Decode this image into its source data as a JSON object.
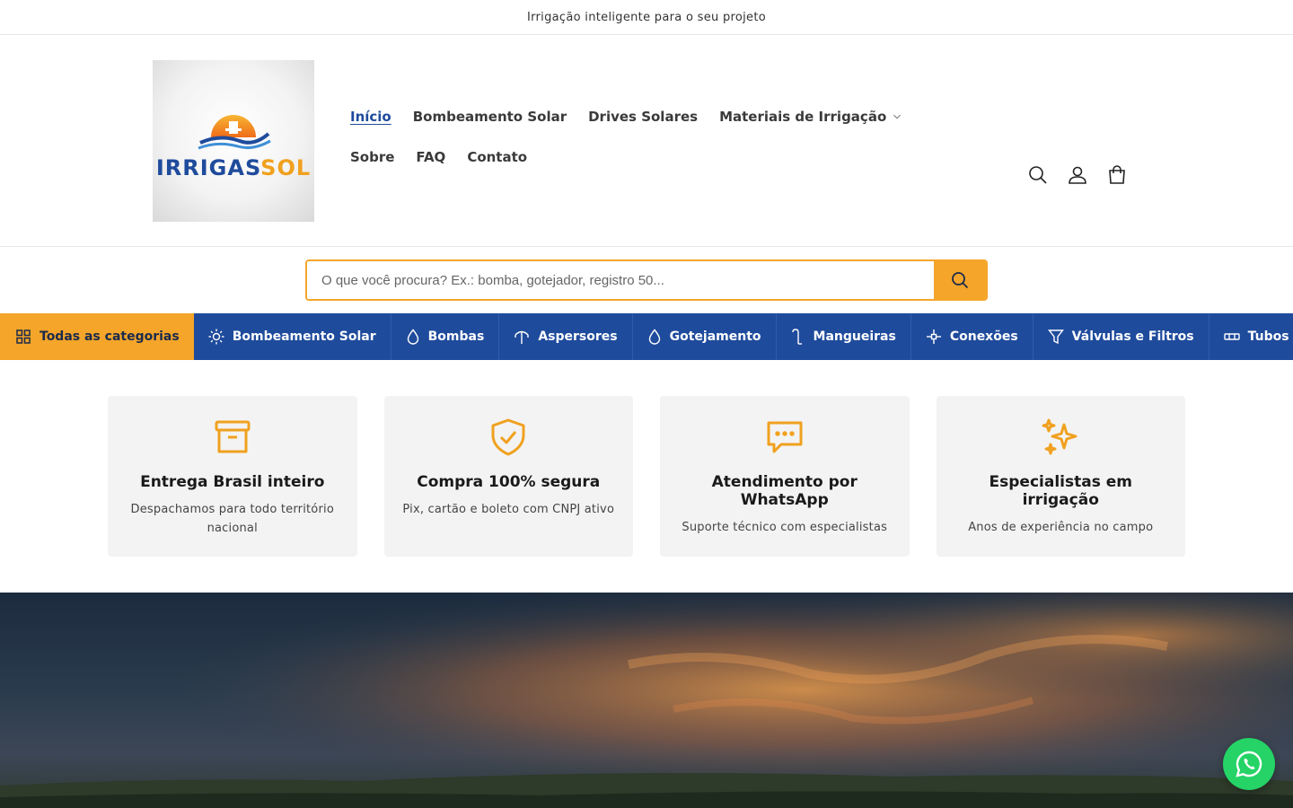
{
  "announcement": {
    "text": "Irrigação inteligente para o seu projeto"
  },
  "logo": {
    "word_a": "IRRIGAS",
    "word_b": "SOL"
  },
  "nav": {
    "items": [
      {
        "label": "Início",
        "active": true
      },
      {
        "label": "Bombeamento Solar"
      },
      {
        "label": "Drives Solares"
      },
      {
        "label": "Materiais de Irrigação",
        "has_dropdown": true
      },
      {
        "label": "Sobre"
      },
      {
        "label": "FAQ"
      },
      {
        "label": "Contato"
      }
    ]
  },
  "header_icons": [
    "search-icon",
    "account-icon",
    "cart-icon"
  ],
  "search": {
    "placeholder": "O que você procura? Ex.: bomba, gotejador, registro 50..."
  },
  "categories": {
    "all_label": "Todas as categorias",
    "items": [
      {
        "label": "Bombeamento Solar",
        "icon": "sun-icon"
      },
      {
        "label": "Bombas",
        "icon": "drop-icon"
      },
      {
        "label": "Aspersores",
        "icon": "sprinkler-icon"
      },
      {
        "label": "Gotejamento",
        "icon": "drop-icon"
      },
      {
        "label": "Mangueiras",
        "icon": "hose-icon"
      },
      {
        "label": "Conexões",
        "icon": "connection-icon"
      },
      {
        "label": "Válvulas e Filtros",
        "icon": "filter-icon"
      },
      {
        "label": "Tubos",
        "icon": "tube-icon"
      }
    ]
  },
  "features": [
    {
      "title": "Entrega Brasil inteiro",
      "desc": "Despachamos para todo território nacional",
      "icon": "archive-icon"
    },
    {
      "title": "Compra 100% segura",
      "desc": "Pix, cartão e boleto com CNPJ ativo",
      "icon": "shield-check-icon"
    },
    {
      "title": "Atendimento por WhatsApp",
      "desc": "Suporte técnico com especialistas",
      "icon": "chat-icon"
    },
    {
      "title": "Especialistas em irrigação",
      "desc": "Anos de experiência no campo",
      "icon": "sparkles-icon"
    }
  ],
  "colors": {
    "brand_blue": "#1f4b9c",
    "brand_orange": "#f4a52a",
    "whatsapp_green": "#25d366"
  }
}
